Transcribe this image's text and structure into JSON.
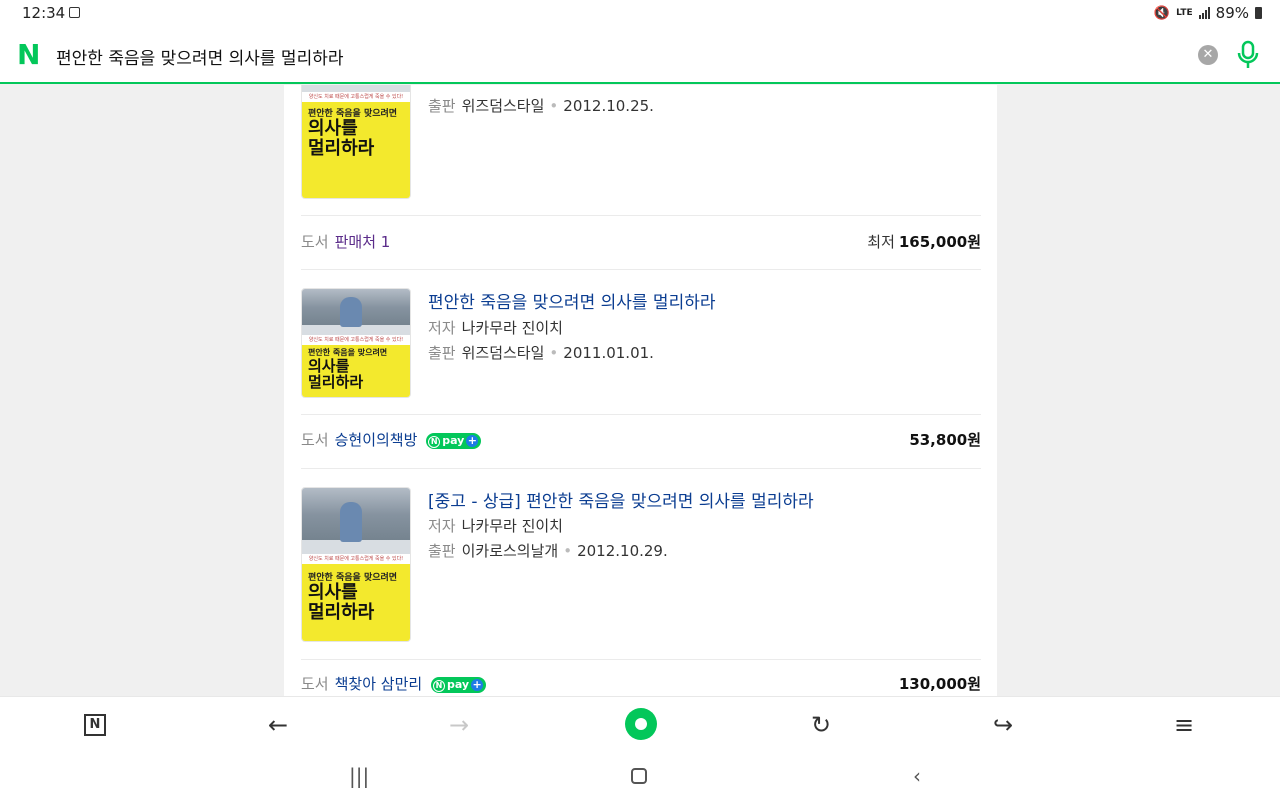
{
  "status_bar": {
    "time": "12:34",
    "network": "LTE",
    "battery": "89%"
  },
  "search": {
    "query": "편안한 죽음을 맞으려면 의사를 멀리하라",
    "logo": "N"
  },
  "book_cover": {
    "strip": "양신도 치료 때문에 고통스럽게 죽을 수 있다!",
    "small": "편안한 죽음을 맞으려면",
    "big1": "의사를",
    "big2": "멀리하라"
  },
  "results": [
    {
      "publisher_label": "출판",
      "publisher": "위즈덤스타일",
      "date": "2012.10.25.",
      "type_label": "도서",
      "seller": "판매처 1",
      "price_prefix": "최저",
      "price": "165,000원"
    },
    {
      "title": "편안한 죽음을 맞으려면 의사를 멀리하라",
      "author_label": "저자",
      "author": "나카무라 진이치",
      "publisher_label": "출판",
      "publisher": "위즈덤스타일",
      "date": "2011.01.01.",
      "type_label": "도서",
      "seller": "승현이의책방",
      "price": "53,800원"
    },
    {
      "title": "[중고 - 상급] 편안한 죽음을 맞으려면 의사를 멀리하라",
      "author_label": "저자",
      "author": "나카무라 진이치",
      "publisher_label": "출판",
      "publisher": "이카로스의날개",
      "date": "2012.10.29.",
      "type_label": "도서",
      "seller": "책찾아 삼만리",
      "price": "130,000원"
    }
  ],
  "npay": {
    "label": "pay",
    "plus": "+"
  },
  "toolbar": {
    "home_icon": "naver-home-icon",
    "back": "←",
    "forward": "→",
    "refresh": "↻",
    "share": "↪",
    "menu": "≡"
  },
  "colors": {
    "naver_green": "#03c75a",
    "link_blue": "#0b3d91",
    "seller_purple": "#5b2c8a"
  }
}
